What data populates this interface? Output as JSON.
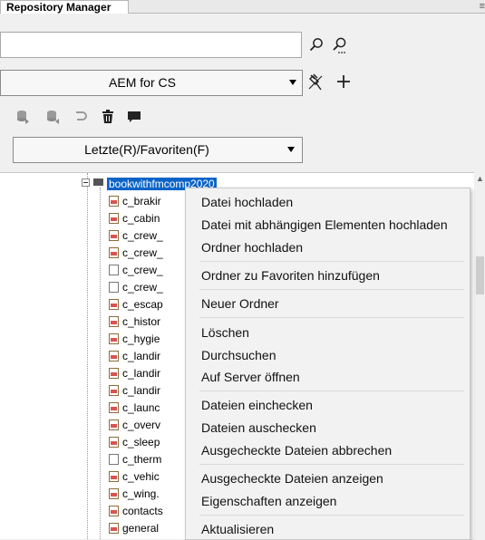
{
  "panel": {
    "tab_title": "Repository Manager"
  },
  "search": {
    "value": "",
    "placeholder": ""
  },
  "connection": {
    "selected": "AEM for CS"
  },
  "filter": {
    "selected": "Letzte(R)/Favoriten(F)"
  },
  "icons": {
    "search": "search-icon",
    "advanced_search": "advanced-search-icon",
    "disconnect": "disconnect-plug-icon",
    "add": "add-icon",
    "toolbar": [
      "checkin-icon",
      "checkout-icon",
      "undo-icon",
      "delete-icon",
      "comment-icon"
    ]
  },
  "tree": {
    "root": "bookwithfmcomp2020",
    "items": [
      "c_brakir",
      "c_cabin",
      "c_crew_",
      "c_crew_",
      "c_crew_",
      "c_crew_",
      "c_escap",
      "c_histor",
      "c_hygie",
      "c_landir",
      "c_landir",
      "c_landir",
      "c_launc",
      "c_overv",
      "c_sleep",
      "c_therm",
      "c_vehic",
      "c_wing.",
      "contacts",
      "general"
    ]
  },
  "context_menu": {
    "items": [
      "Datei hochladen",
      "Datei mit abhängigen Elementen hochladen",
      "Ordner hochladen",
      "Ordner zu Favoriten hinzufügen",
      "Neuer Ordner",
      "Löschen",
      "Durchsuchen",
      "Auf Server öffnen",
      "Dateien einchecken",
      "Dateien auschecken",
      "Ausgecheckte Dateien abbrechen",
      "Ausgecheckte Dateien anzeigen",
      "Eigenschaften anzeigen",
      "Aktualisieren"
    ]
  }
}
